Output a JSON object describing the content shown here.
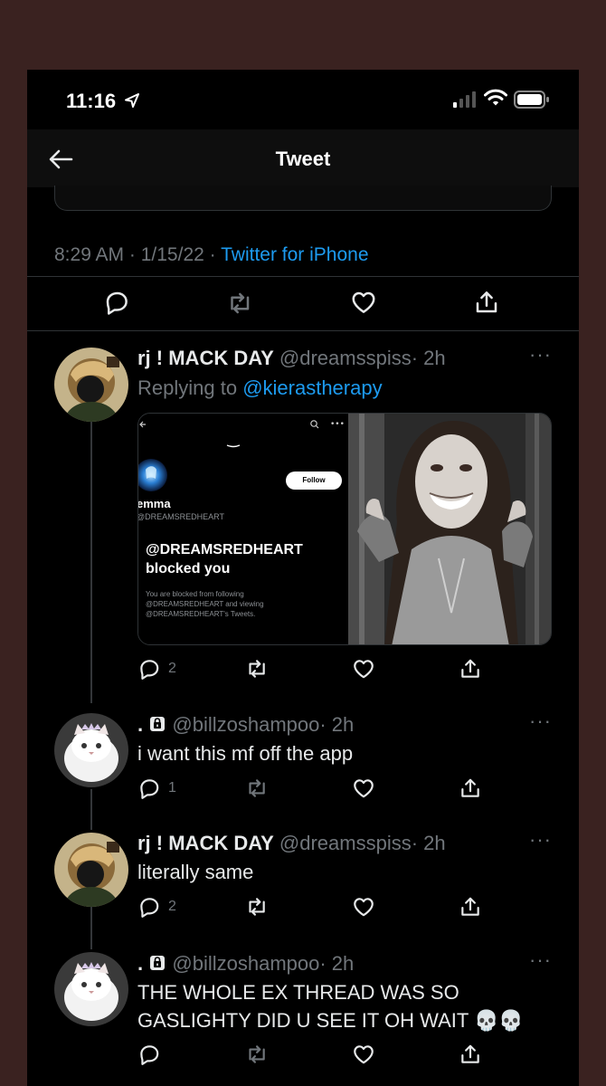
{
  "status_bar": {
    "time": "11:16"
  },
  "nav": {
    "title": "Tweet"
  },
  "main_tweet": {
    "time": "8:29 AM",
    "sep1": " · ",
    "date": "1/15/22",
    "sep2": " · ",
    "source": "Twitter for iPhone"
  },
  "replies": [
    {
      "name": "rj ! MACK DAY",
      "handle": "@dreamsspiss",
      "age": "· 2h",
      "replying_prefix": "Replying to ",
      "replying_to": "@kierastherapy",
      "reply_count": "2",
      "media": {
        "profile_name": "emma",
        "profile_handle": "@DREAMSREDHEART",
        "follow": "Follow",
        "blocked_handle": "@DREAMSREDHEART",
        "blocked_text": "blocked you",
        "blocked_info": "You are blocked from following @DREAMSREDHEART and viewing @DREAMSREDHEART's Tweets."
      }
    },
    {
      "name": ".",
      "handle": "@billzoshampoo",
      "age": "· 2h",
      "text": "i want this mf off the app",
      "reply_count": "1"
    },
    {
      "name": "rj ! MACK DAY",
      "handle": "@dreamsspiss",
      "age": "· 2h",
      "text": "literally same",
      "reply_count": "2"
    },
    {
      "name": ".",
      "handle": "@billzoshampoo",
      "age": "· 2h",
      "text": "THE WHOLE EX THREAD WAS SO GASLIGHTY DID U SEE IT OH WAIT 💀💀",
      "reply_count": ""
    }
  ],
  "icons": {
    "reply": "speech-bubble-icon",
    "retweet": "retweet-icon",
    "like": "heart-icon",
    "share": "share-icon",
    "more": "more-dots-icon",
    "lock": "lock-icon"
  },
  "colors": {
    "accent": "#1d9bf0",
    "muted": "#71767b",
    "background": "#000000",
    "frame": "#3a2220"
  }
}
